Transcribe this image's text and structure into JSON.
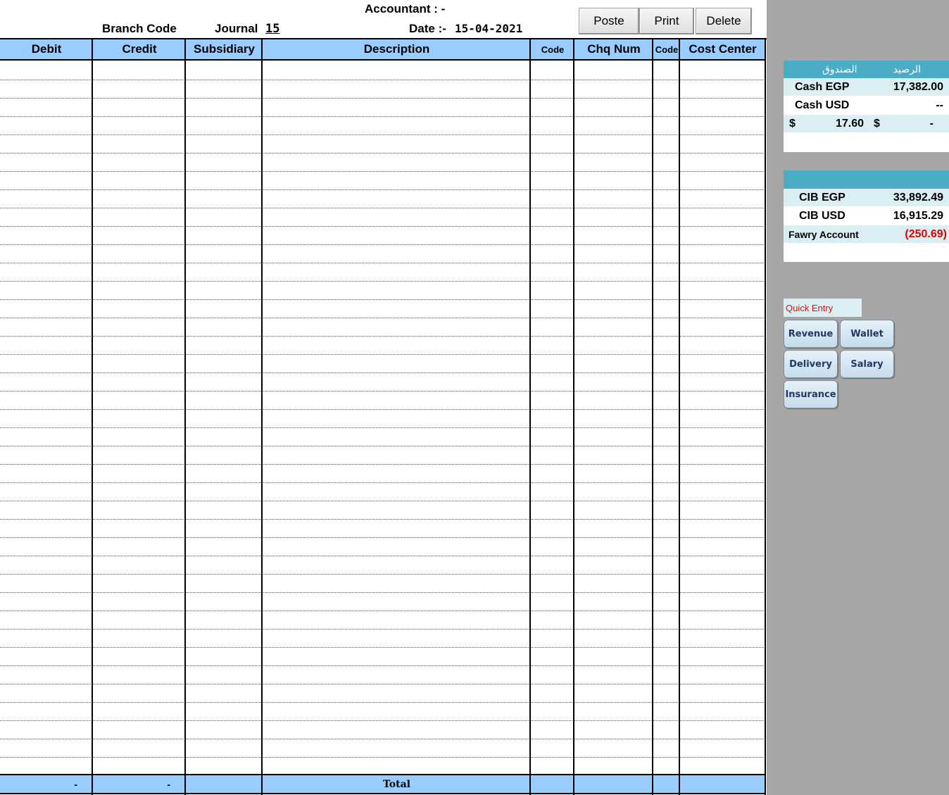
{
  "header": {
    "accountant": "Accountant : -",
    "branch_code": "Branch Code",
    "journal_label": "Journal",
    "journal_number": "15",
    "date_label": "Date :-",
    "date_value": "15-04-2021"
  },
  "toolbar": {
    "poste": "Poste",
    "print": "Print",
    "delete": "Delete"
  },
  "table": {
    "columns": [
      "Debit",
      "Credit",
      "Subsidiary",
      "Description",
      "Code",
      "Chq Num",
      "Code",
      "Cost Center"
    ],
    "footer": {
      "debit_total": "-",
      "credit_total": "-",
      "total_label": "Total"
    }
  },
  "cash_box": {
    "header_left": "الصندوق",
    "header_right": "الرصيد",
    "rows": [
      {
        "label": "Cash EGP",
        "value": "17,382.00"
      },
      {
        "label": "Cash USD",
        "value": "--"
      }
    ],
    "rate_row": {
      "symbol1": "$",
      "value1": "17.60",
      "symbol2": "$",
      "value2": "-"
    }
  },
  "bank_box": {
    "rows": [
      {
        "label": "CIB EGP",
        "value": "33,892.49"
      },
      {
        "label": "CIB USD",
        "value": "16,915.29"
      },
      {
        "label": "Fawry Account",
        "value": "(250.69)"
      }
    ]
  },
  "quick_entry": {
    "label": "Quick Entry",
    "buttons": [
      "Revenue",
      "Wallet",
      "Delivery",
      "Salary",
      "Insurance"
    ]
  },
  "colors": {
    "header_blue": "#99ccff",
    "panel_gray": "#a6a6a6",
    "card_teal": "#4bacc6",
    "card_light": "#daeef3",
    "negative": "#e00000"
  }
}
